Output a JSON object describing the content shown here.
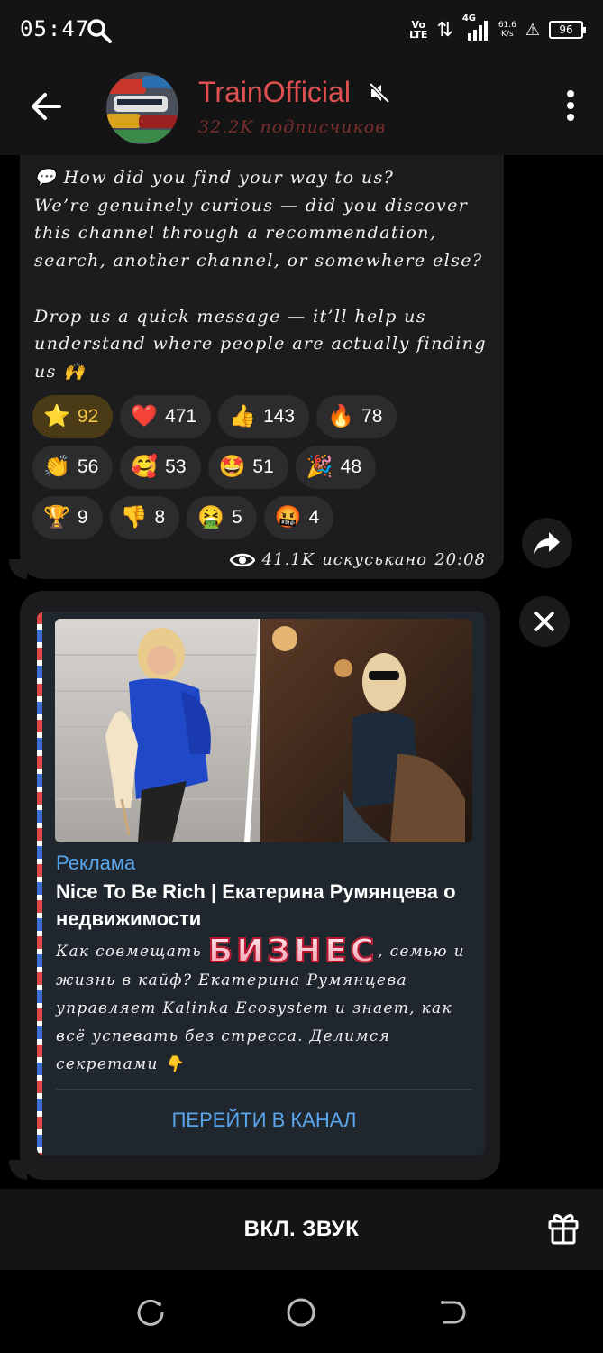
{
  "status_bar": {
    "time": "05:47",
    "network_top": "Vo",
    "network_bottom": "LTE",
    "signal_type": "4G",
    "speed_value": "61.6",
    "speed_unit": "K/s",
    "battery": "96"
  },
  "header": {
    "channel_name": "TrainOfficial",
    "subscribers": "32.2K подписчиков",
    "title_color": "#e05050"
  },
  "message": {
    "text": "💬 How did you find your way to us?\nWe’re genuinely curious — did you discover this channel through a recommendation, search, another channel, or somewhere else?\n\nDrop us a quick message — it’ll help us understand where people are actually finding us 🙌",
    "reactions": [
      {
        "emoji": "⭐",
        "count": "92",
        "active": true
      },
      {
        "emoji": "❤️",
        "count": "471"
      },
      {
        "emoji": "👍",
        "count": "143"
      },
      {
        "emoji": "🔥",
        "count": "78"
      },
      {
        "emoji": "👏",
        "count": "56"
      },
      {
        "emoji": "🥰",
        "count": "53"
      },
      {
        "emoji": "🤩",
        "count": "51"
      },
      {
        "emoji": "🎉",
        "count": "48"
      },
      {
        "emoji": "🏆",
        "count": "9"
      },
      {
        "emoji": "👎",
        "count": "8"
      },
      {
        "emoji": "🤮",
        "count": "5"
      },
      {
        "emoji": "🤬",
        "count": "4"
      }
    ],
    "views": "41.1K",
    "edited_label": "искуськано",
    "time": "20:08"
  },
  "ad": {
    "label": "Реклама",
    "title": "Nice To Be Rich | Екатерина Румянцева о недвижимости",
    "body_before": "Как совмещать ",
    "body_highlight": "БИЗНЕС",
    "body_after": ", семью и жизнь в кайф? Екатерина Румянцева управляет Kalinka Ecosystem и знает, как всё успевать без стресса. Делимся секретами 👇",
    "cta": "ПЕРЕЙТИ В КАНАЛ"
  },
  "bottom": {
    "unmute_label": "ВКЛ. ЗВУК"
  },
  "icons": {
    "back": "arrow-left-icon",
    "mute": "speaker-muted-icon",
    "menu": "more-vertical-icon",
    "forward": "share-icon",
    "close": "close-icon",
    "gift": "gift-icon"
  }
}
